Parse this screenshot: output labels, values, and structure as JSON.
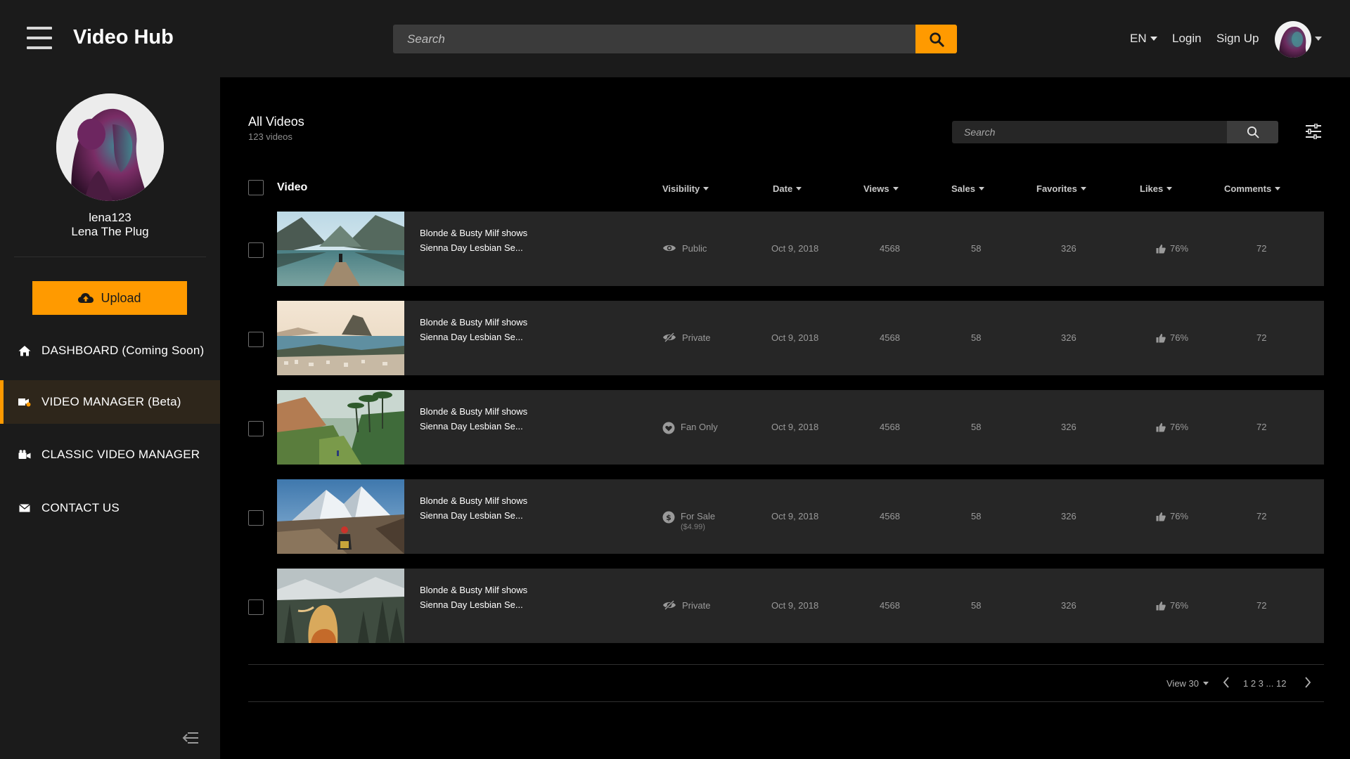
{
  "app": {
    "title": "Video Hub"
  },
  "header": {
    "search_placeholder": "Search",
    "language": "EN",
    "login": "Login",
    "signup": "Sign Up"
  },
  "colors": {
    "accent": "#ff9a00",
    "background": "#000000",
    "panel": "#1b1b1b",
    "row": "#262626"
  },
  "sidebar": {
    "username": "lena123",
    "display_name": "Lena The Plug",
    "upload_label": "Upload",
    "items": [
      {
        "label": "DASHBOARD (Coming Soon)",
        "icon": "home-icon"
      },
      {
        "label": "VIDEO MANAGER (Beta)",
        "icon": "video-tag-icon",
        "active": true
      },
      {
        "label": "CLASSIC VIDEO MANAGER",
        "icon": "camera-icon"
      },
      {
        "label": "CONTACT US",
        "icon": "envelope-icon"
      }
    ]
  },
  "main": {
    "title": "All Videos",
    "count": "123 videos",
    "search_placeholder": "Search",
    "columns": {
      "video": "Video",
      "visibility": "Visibility",
      "date": "Date",
      "views": "Views",
      "sales": "Sales",
      "favorites": "Favorites",
      "likes": "Likes",
      "comments": "Comments"
    },
    "rows": [
      {
        "title_line1": "Blonde & Busty Milf shows",
        "title_line2": "Sienna Day Lesbian Se...",
        "visibility": "Public",
        "visibility_sub": "",
        "vis_icon": "eye-icon",
        "date": "Oct 9, 2018",
        "views": "4568",
        "sales": "58",
        "favorites": "326",
        "likes": "76%",
        "comments": "72",
        "thumb": "lake-dock"
      },
      {
        "title_line1": "Blonde & Busty Milf shows",
        "title_line2": "Sienna Day Lesbian Se...",
        "visibility": "Private",
        "visibility_sub": "",
        "vis_icon": "eye-slash-icon",
        "date": "Oct 9, 2018",
        "views": "4568",
        "sales": "58",
        "favorites": "326",
        "likes": "76%",
        "comments": "72",
        "thumb": "coastal-city"
      },
      {
        "title_line1": "Blonde & Busty Milf shows",
        "title_line2": "Sienna Day Lesbian Se...",
        "visibility": "Fan Only",
        "visibility_sub": "",
        "vis_icon": "heart-icon",
        "date": "Oct 9, 2018",
        "views": "4568",
        "sales": "58",
        "favorites": "326",
        "likes": "76%",
        "comments": "72",
        "thumb": "rice-terraces"
      },
      {
        "title_line1": "Blonde & Busty Milf shows",
        "title_line2": "Sienna Day Lesbian Se...",
        "visibility": "For Sale",
        "visibility_sub": "($4.99)",
        "vis_icon": "dollar-icon",
        "date": "Oct 9, 2018",
        "views": "4568",
        "sales": "58",
        "favorites": "326",
        "likes": "76%",
        "comments": "72",
        "thumb": "snowy-mountain"
      },
      {
        "title_line1": "Blonde & Busty Milf shows",
        "title_line2": "Sienna Day Lesbian Se...",
        "visibility": "Private",
        "visibility_sub": "",
        "vis_icon": "eye-slash-icon",
        "date": "Oct 9, 2018",
        "views": "4568",
        "sales": "58",
        "favorites": "326",
        "likes": "76%",
        "comments": "72",
        "thumb": "misty-forest"
      }
    ],
    "pagination": {
      "view_label": "View 30",
      "pages": "1 2 3 ... 12"
    }
  }
}
